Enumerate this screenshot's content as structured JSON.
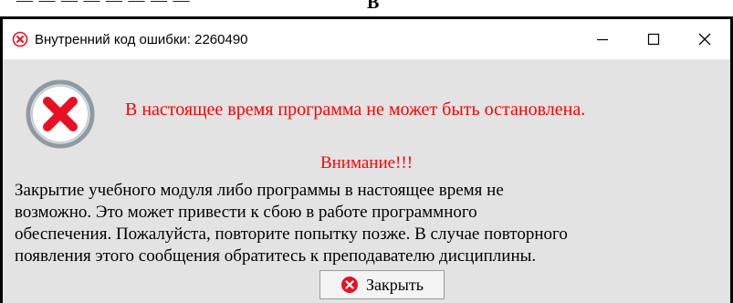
{
  "background": {
    "partial_text": "— — — — — — — —",
    "partial_letter": "B"
  },
  "titlebar": {
    "title": "Внутренний код ошибки: 2260490",
    "icon": "error-icon"
  },
  "window_controls": {
    "minimize_icon": "minimize-icon",
    "maximize_icon": "maximize-icon",
    "close_icon": "close-icon"
  },
  "message": {
    "main": "В настоящее время программа не может быть остановлена.",
    "attention": "Внимание!!!",
    "body_lines": [
      "Закрытие учебного модуля либо программы в настоящее время не",
      "возможно. Это может привести к сбою в работе программного",
      "обеспечения. Пожалуйста, повторите попытку позже. В случае повторного",
      "появления этого сообщения обратитесь к преподавателю дисциплины."
    ],
    "icon": "error-icon"
  },
  "buttons": {
    "close_label": "Закрыть",
    "close_icon": "error-icon"
  },
  "colors": {
    "error_red": "#e81123",
    "message_red": "#ff0000",
    "dialog_bg": "#e3e3e3",
    "titlebar_bg": "#ffffff"
  }
}
